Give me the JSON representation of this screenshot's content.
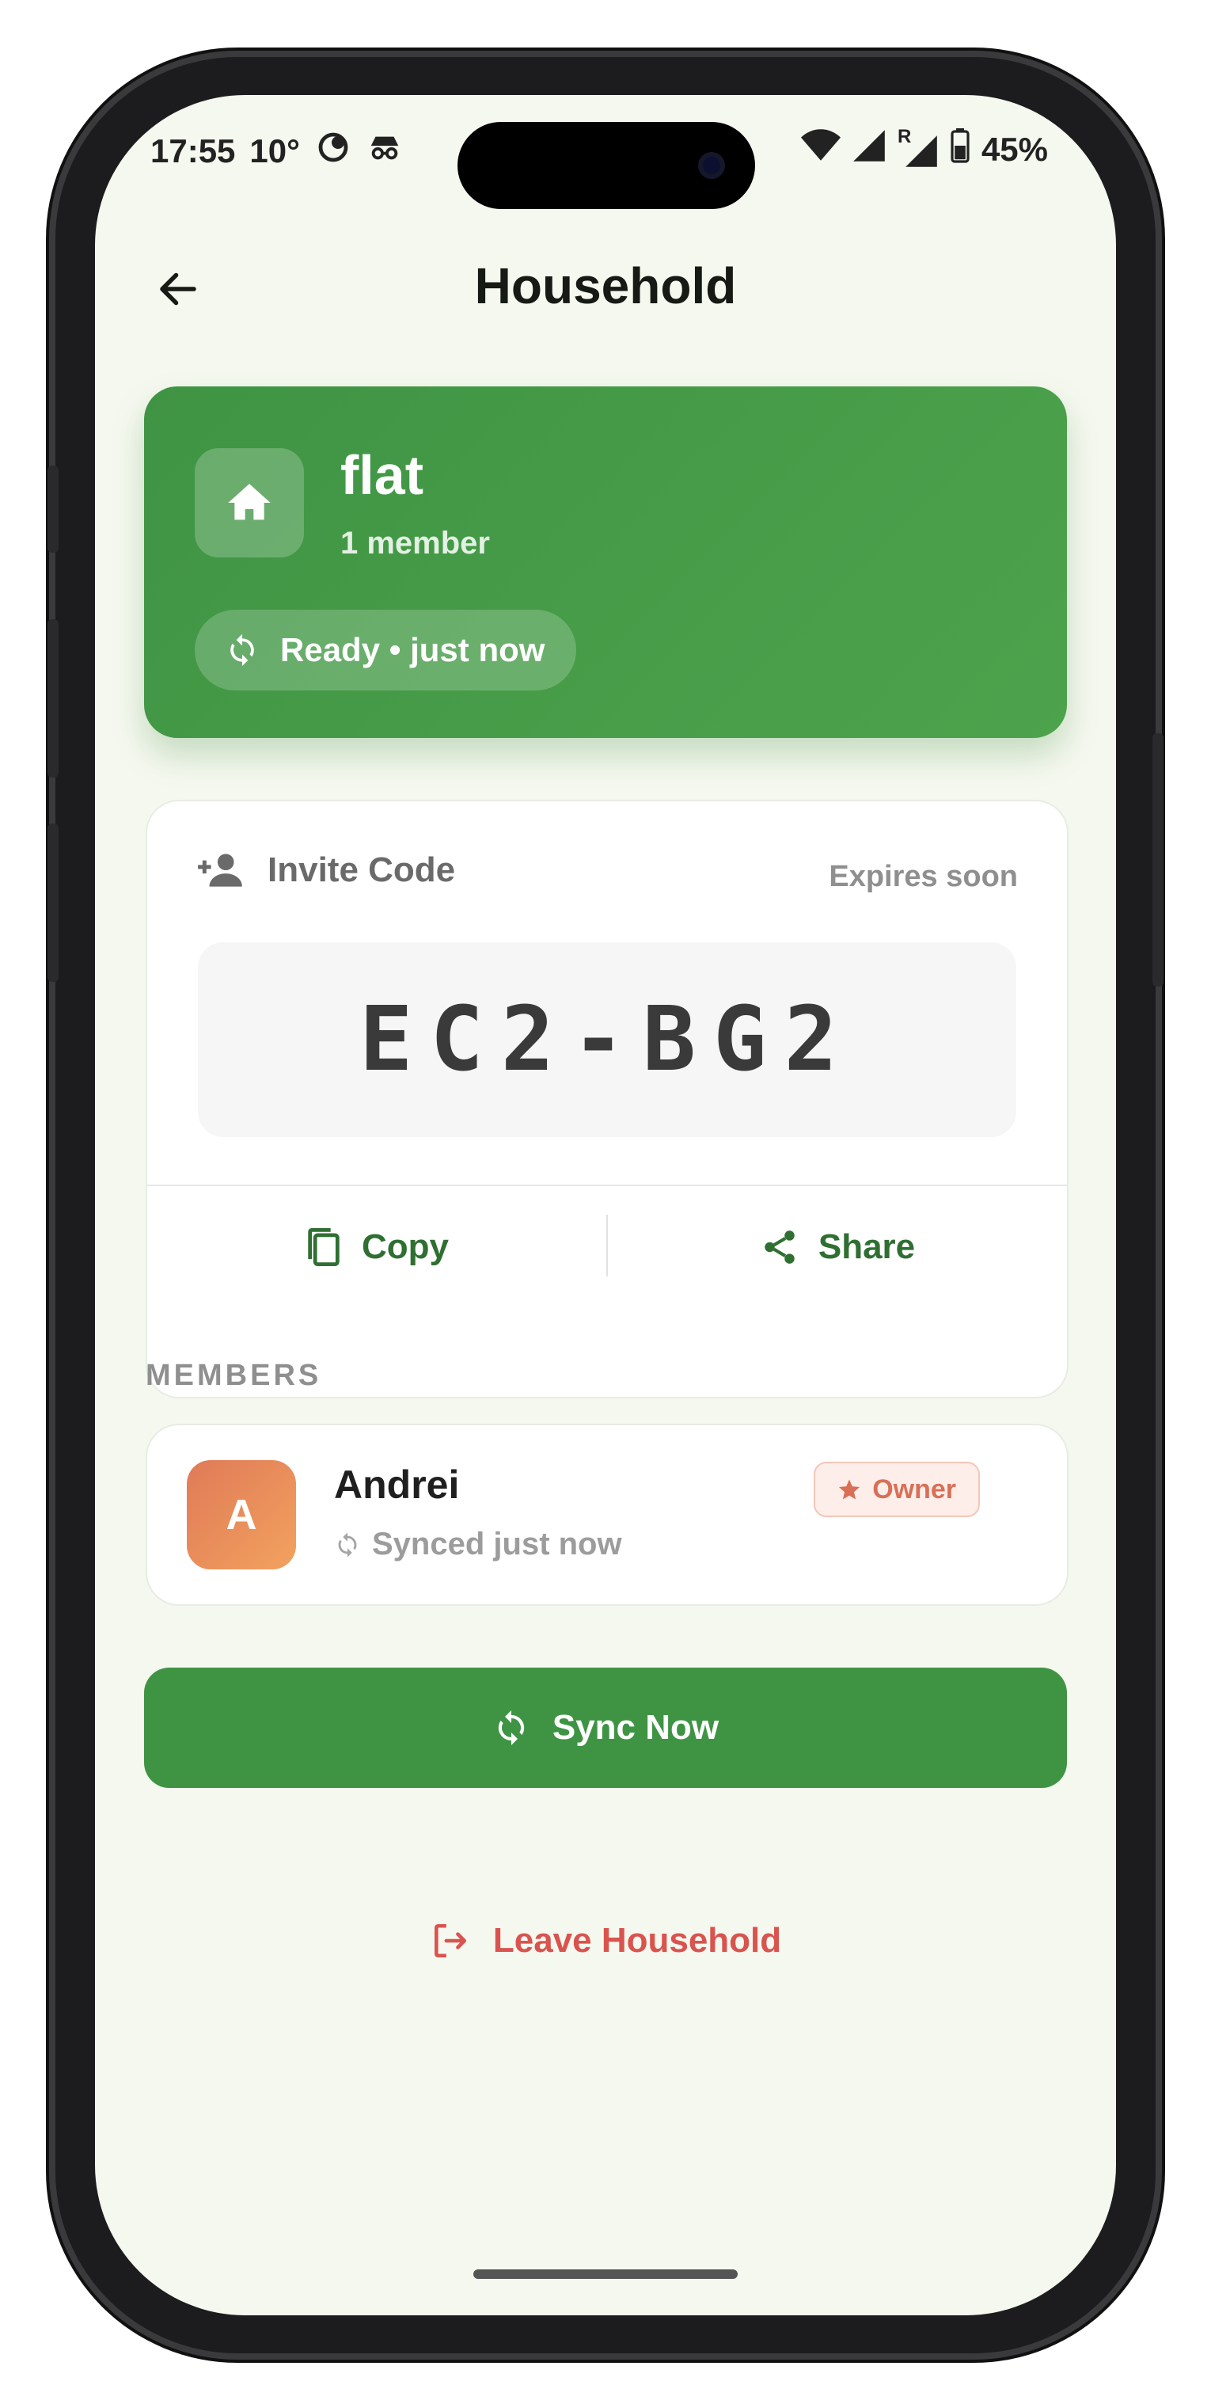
{
  "status_bar": {
    "time": "17:55",
    "temperature": "10°",
    "battery_percent": "45%",
    "icons": [
      "weather-icon",
      "incognito-icon",
      "wifi-icon",
      "signal-icon",
      "roaming-signal-icon",
      "battery-icon"
    ],
    "roaming_mark": "R"
  },
  "app_bar": {
    "title": "Household",
    "back_icon": "arrow-left-icon"
  },
  "household": {
    "name": "flat",
    "member_count_label": "1 member",
    "sync_status": "Ready • just now",
    "icon": "home-icon"
  },
  "invite": {
    "title": "Invite Code",
    "expiry": "Expires soon",
    "code": "EC2-BG2",
    "copy_label": "Copy",
    "share_label": "Share"
  },
  "members": {
    "section_label": "MEMBERS",
    "items": [
      {
        "initial": "A",
        "name": "Andrei",
        "status": "Synced just now",
        "role": "Owner"
      }
    ]
  },
  "actions": {
    "sync_label": "Sync Now",
    "leave_label": "Leave Household"
  },
  "colors": {
    "primary_green": "#3f9444",
    "background": "#f5f8ef",
    "danger": "#d9534f",
    "owner_accent": "#d86f56"
  }
}
